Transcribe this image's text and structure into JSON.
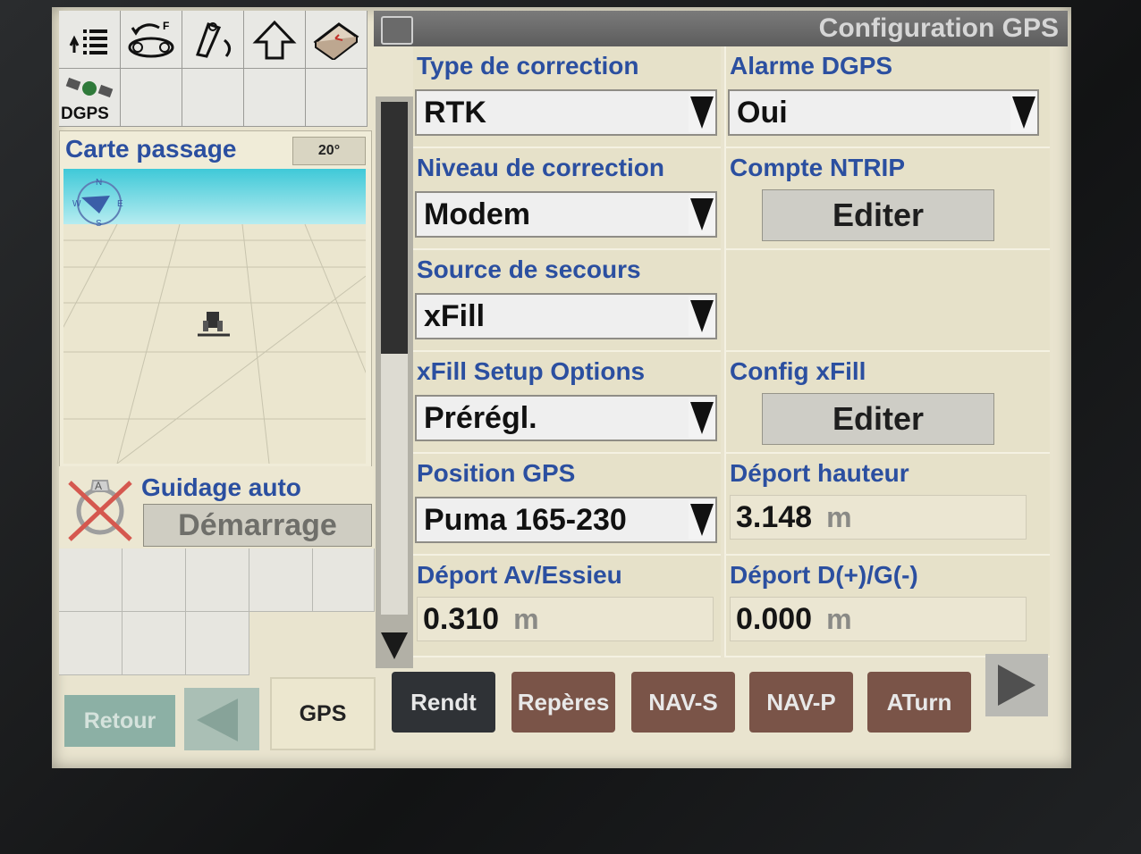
{
  "toolbar": {
    "icons": [
      "list-up-icon",
      "belt-rotation-icon",
      "hitch-rotation-icon",
      "arrow-up-icon",
      "book-icon",
      "dgps-satellite-icon"
    ],
    "dgps_label": "DGPS"
  },
  "map": {
    "title": "Carte passage",
    "angle": "20°",
    "compass": {
      "n": "N",
      "s": "S",
      "e": "E",
      "w": "W"
    }
  },
  "guidance": {
    "title": "Guidage auto",
    "start_label": "Démarrage",
    "icon_letter": "A"
  },
  "header": {
    "title": "Configuration GPS"
  },
  "settings": {
    "correction_type": {
      "label": "Type de correction",
      "value": "RTK"
    },
    "dgps_alarm": {
      "label": "Alarme DGPS",
      "value": "Oui"
    },
    "correction_level": {
      "label": "Niveau de correction",
      "value": "Modem"
    },
    "ntrip_account": {
      "label": "Compte NTRIP",
      "button": "Editer"
    },
    "backup_source": {
      "label": "Source de secours",
      "value": "xFill"
    },
    "xfill_setup": {
      "label": "xFill Setup Options",
      "value": "Prérégl."
    },
    "xfill_config": {
      "label": "Config xFill",
      "button": "Editer"
    },
    "gps_position": {
      "label": "Position GPS",
      "value": "Puma 165-230"
    },
    "height_offset": {
      "label": "Déport hauteur",
      "value": "3.148",
      "unit": "m"
    },
    "fore_aft_offset": {
      "label": "Déport Av/Essieu",
      "value": "0.310",
      "unit": "m"
    },
    "lateral_offset": {
      "label": "Déport D(+)/G(-)",
      "value": "0.000",
      "unit": "m"
    }
  },
  "nav": {
    "back": "Retour",
    "current_tab": "GPS",
    "tabs": [
      "Rendt",
      "Repères",
      "NAV-S",
      "NAV-P",
      "ATurn"
    ]
  }
}
